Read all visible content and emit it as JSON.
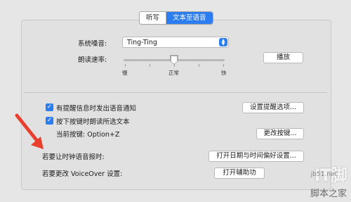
{
  "tabs": [
    {
      "label": "听写",
      "active": false
    },
    {
      "label": "文本至语音",
      "active": true
    }
  ],
  "voice": {
    "label": "系统嗓音:",
    "value": "Ting-Ting"
  },
  "rate": {
    "label": "朗读速率:",
    "slow": "慢",
    "normal": "正常",
    "fast": "快",
    "level": 0.5,
    "play_label": "播放"
  },
  "options": {
    "alert_checkbox": {
      "label": "有提醒信息时发出语音通知",
      "checked": true
    },
    "alert_button": "设置提醒选项...",
    "key_checkbox": {
      "label": "按下按键时朗读所选文本",
      "checked": true
    },
    "current_key": "当前按键: Option+Z",
    "change_key_button": "更改按键...",
    "clock_label": "若要让时钟语音报时:",
    "clock_button": "打开日期与时间偏好设置...",
    "voiceover_label": "若要更改 VoiceOver 设置:",
    "voiceover_button": "打开辅助功"
  },
  "watermark": {
    "big": "IT脚",
    "site": "jb51.net",
    "text": "脚本之家"
  },
  "colors": {
    "accent": "#2b7df0",
    "arrow": "#e8402c"
  }
}
